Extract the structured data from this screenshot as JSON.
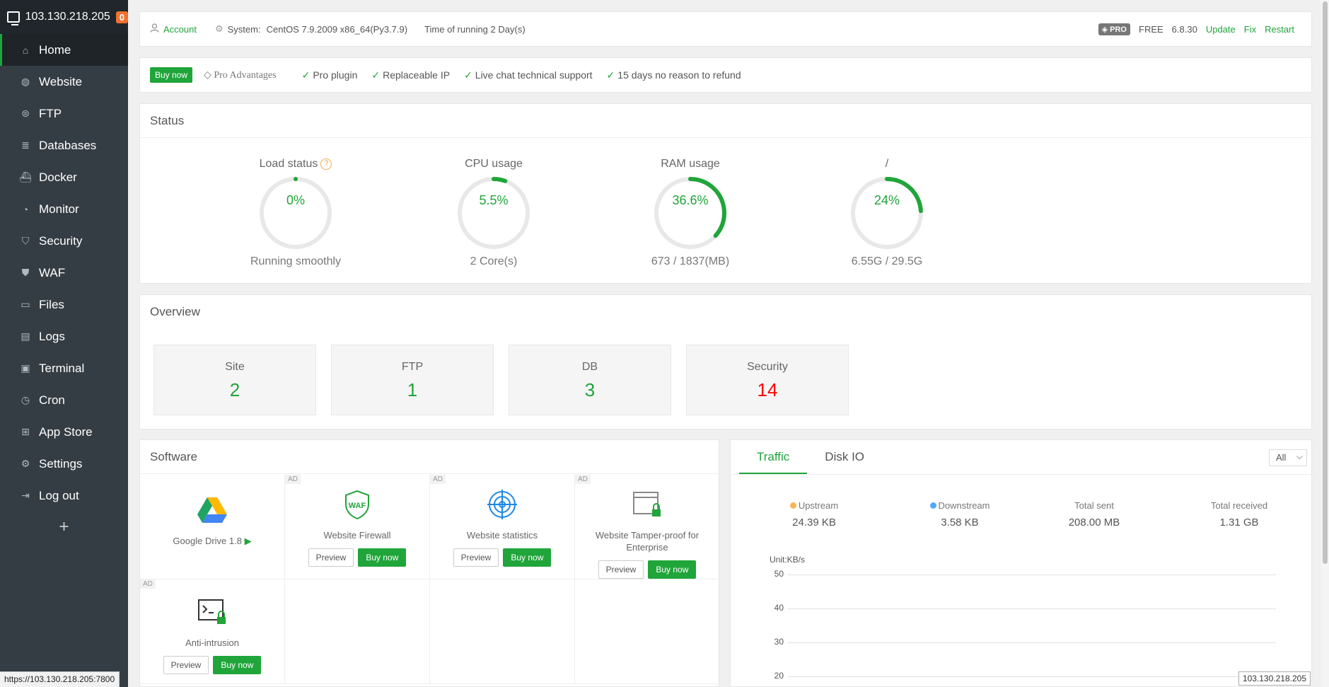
{
  "sidebar": {
    "ip": "103.130.218.205",
    "badge": "0",
    "items": [
      {
        "label": "Home",
        "icon": "home-icon",
        "glyph": "⌂"
      },
      {
        "label": "Website",
        "icon": "globe-icon",
        "glyph": "◍"
      },
      {
        "label": "FTP",
        "icon": "ftp-icon",
        "glyph": "⊜"
      },
      {
        "label": "Databases",
        "icon": "database-icon",
        "glyph": "≣"
      },
      {
        "label": "Docker",
        "icon": "docker-icon",
        "glyph": "⛴"
      },
      {
        "label": "Monitor",
        "icon": "monitor-icon",
        "glyph": "◔"
      },
      {
        "label": "Security",
        "icon": "shield-icon",
        "glyph": "⛉"
      },
      {
        "label": "WAF",
        "icon": "waf-shield-icon",
        "glyph": "⛊"
      },
      {
        "label": "Files",
        "icon": "folder-icon",
        "glyph": "▭"
      },
      {
        "label": "Logs",
        "icon": "log-icon",
        "glyph": "▤"
      },
      {
        "label": "Terminal",
        "icon": "terminal-icon",
        "glyph": "▣"
      },
      {
        "label": "Cron",
        "icon": "clock-icon",
        "glyph": "◷"
      },
      {
        "label": "App Store",
        "icon": "grid-icon",
        "glyph": "⊞"
      },
      {
        "label": "Settings",
        "icon": "gear-icon",
        "glyph": "⚙"
      },
      {
        "label": "Log out",
        "icon": "logout-icon",
        "glyph": "⇥"
      }
    ],
    "add": "+"
  },
  "topbar": {
    "account": "Account",
    "system_label": "System:",
    "system_value": "CentOS 7.9.2009 x86_64(Py3.7.9)",
    "uptime": "Time of running 2 Day(s)",
    "pro": "PRO",
    "free": "FREE",
    "version": "6.8.30",
    "update": "Update",
    "fix": "Fix",
    "restart": "Restart"
  },
  "promo": {
    "buy": "Buy now",
    "advantages": "Pro Advantages",
    "features": [
      "Pro plugin",
      "Replaceable IP",
      "Live chat technical support",
      "15 days no reason to refund"
    ]
  },
  "status": {
    "title": "Status",
    "gauges": [
      {
        "label": "Load status",
        "value": "0%",
        "percent": 0,
        "sub": "Running smoothly",
        "help": "?"
      },
      {
        "label": "CPU usage",
        "value": "5.5%",
        "percent": 5.5,
        "sub": "2 Core(s)"
      },
      {
        "label": "RAM usage",
        "value": "36.6%",
        "percent": 36.6,
        "sub": "673 / 1837(MB)"
      },
      {
        "label": "/",
        "value": "24%",
        "percent": 24,
        "sub": "6.55G / 29.5G"
      }
    ],
    "accent": "#20a53a"
  },
  "overview": {
    "title": "Overview",
    "cards": [
      {
        "label": "Site",
        "value": "2"
      },
      {
        "label": "FTP",
        "value": "1"
      },
      {
        "label": "DB",
        "value": "3"
      },
      {
        "label": "Security",
        "value": "14"
      }
    ]
  },
  "software": {
    "title": "Software",
    "ad": "AD",
    "preview": "Preview",
    "buy": "Buy now",
    "items": [
      {
        "name": "Google Drive 1.8",
        "ad": false
      },
      {
        "name": "Website Firewall",
        "ad": true
      },
      {
        "name": "Website statistics",
        "ad": true
      },
      {
        "name": "Website Tamper-proof for Enterprise",
        "ad": true
      },
      {
        "name": "Anti-intrusion",
        "ad": true
      }
    ],
    "waf_text": "WAF"
  },
  "traffic": {
    "tabs": [
      "Traffic",
      "Disk IO"
    ],
    "select": "All",
    "stats": [
      {
        "label": "Upstream",
        "value": "24.39 KB",
        "color": "#f7b851"
      },
      {
        "label": "Downstream",
        "value": "3.58 KB",
        "color": "#52a9ff"
      },
      {
        "label": "Total sent",
        "value": "208.00 MB"
      },
      {
        "label": "Total received",
        "value": "1.31 GB"
      }
    ],
    "unit": "Unit:KB/s",
    "yticks": [
      "50",
      "40",
      "30",
      "20"
    ]
  },
  "browser": {
    "status_url": "https://103.130.218.205:7800",
    "tooltip": "103.130.218.205"
  }
}
